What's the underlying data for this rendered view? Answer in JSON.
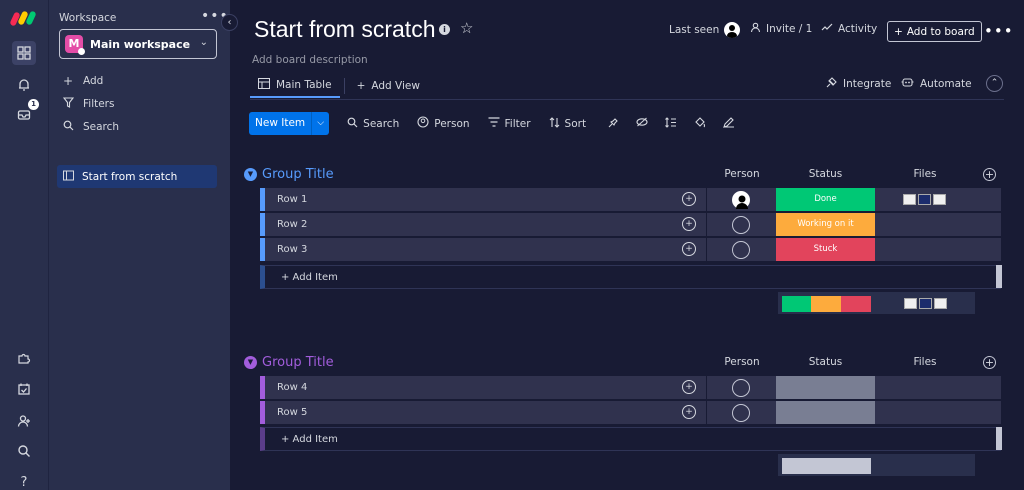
{
  "sidebar": {
    "workspace_label": "Workspace",
    "more": "•••",
    "workspace_name": "Main workspace",
    "workspace_initial": "M",
    "actions": [
      {
        "icon": "plus-icon",
        "label": "Add"
      },
      {
        "icon": "filter-icon",
        "label": "Filters"
      },
      {
        "icon": "search-icon",
        "label": "Search"
      }
    ],
    "board_item": "Start from scratch",
    "notifications_badge": "1"
  },
  "header": {
    "title": "Start from scratch",
    "description": "Add board description",
    "last_seen": "Last seen",
    "invite": "Invite / 1",
    "activity": "Activity",
    "add_to_board": "Add to board",
    "more": "•••"
  },
  "views": {
    "main_table": "Main Table",
    "add_view": "Add View",
    "integrate": "Integrate",
    "automate": "Automate"
  },
  "toolbar": {
    "new_item": "New Item",
    "search": "Search",
    "person": "Person",
    "filter": "Filter",
    "sort": "Sort"
  },
  "columns": {
    "person": "Person",
    "status": "Status",
    "files": "Files"
  },
  "groups": [
    {
      "title": "Group Title",
      "color": "#579bfc",
      "add_item": "+ Add Item",
      "rows": [
        {
          "name": "Row 1",
          "status": "Done",
          "status_color": "#00c875",
          "person_assigned": true,
          "has_files": true
        },
        {
          "name": "Row 2",
          "status": "Working on it",
          "status_color": "#fdab3d",
          "person_assigned": false,
          "has_files": false
        },
        {
          "name": "Row 3",
          "status": "Stuck",
          "status_color": "#e2445c",
          "person_assigned": false,
          "has_files": false
        }
      ]
    },
    {
      "title": "Group Title",
      "color": "#a25ddc",
      "add_item": "+ Add Item",
      "rows": [
        {
          "name": "Row 4",
          "status": "",
          "status_color": "#797e93",
          "person_assigned": false,
          "has_files": false
        },
        {
          "name": "Row 5",
          "status": "",
          "status_color": "#797e93",
          "person_assigned": false,
          "has_files": false
        }
      ]
    }
  ]
}
